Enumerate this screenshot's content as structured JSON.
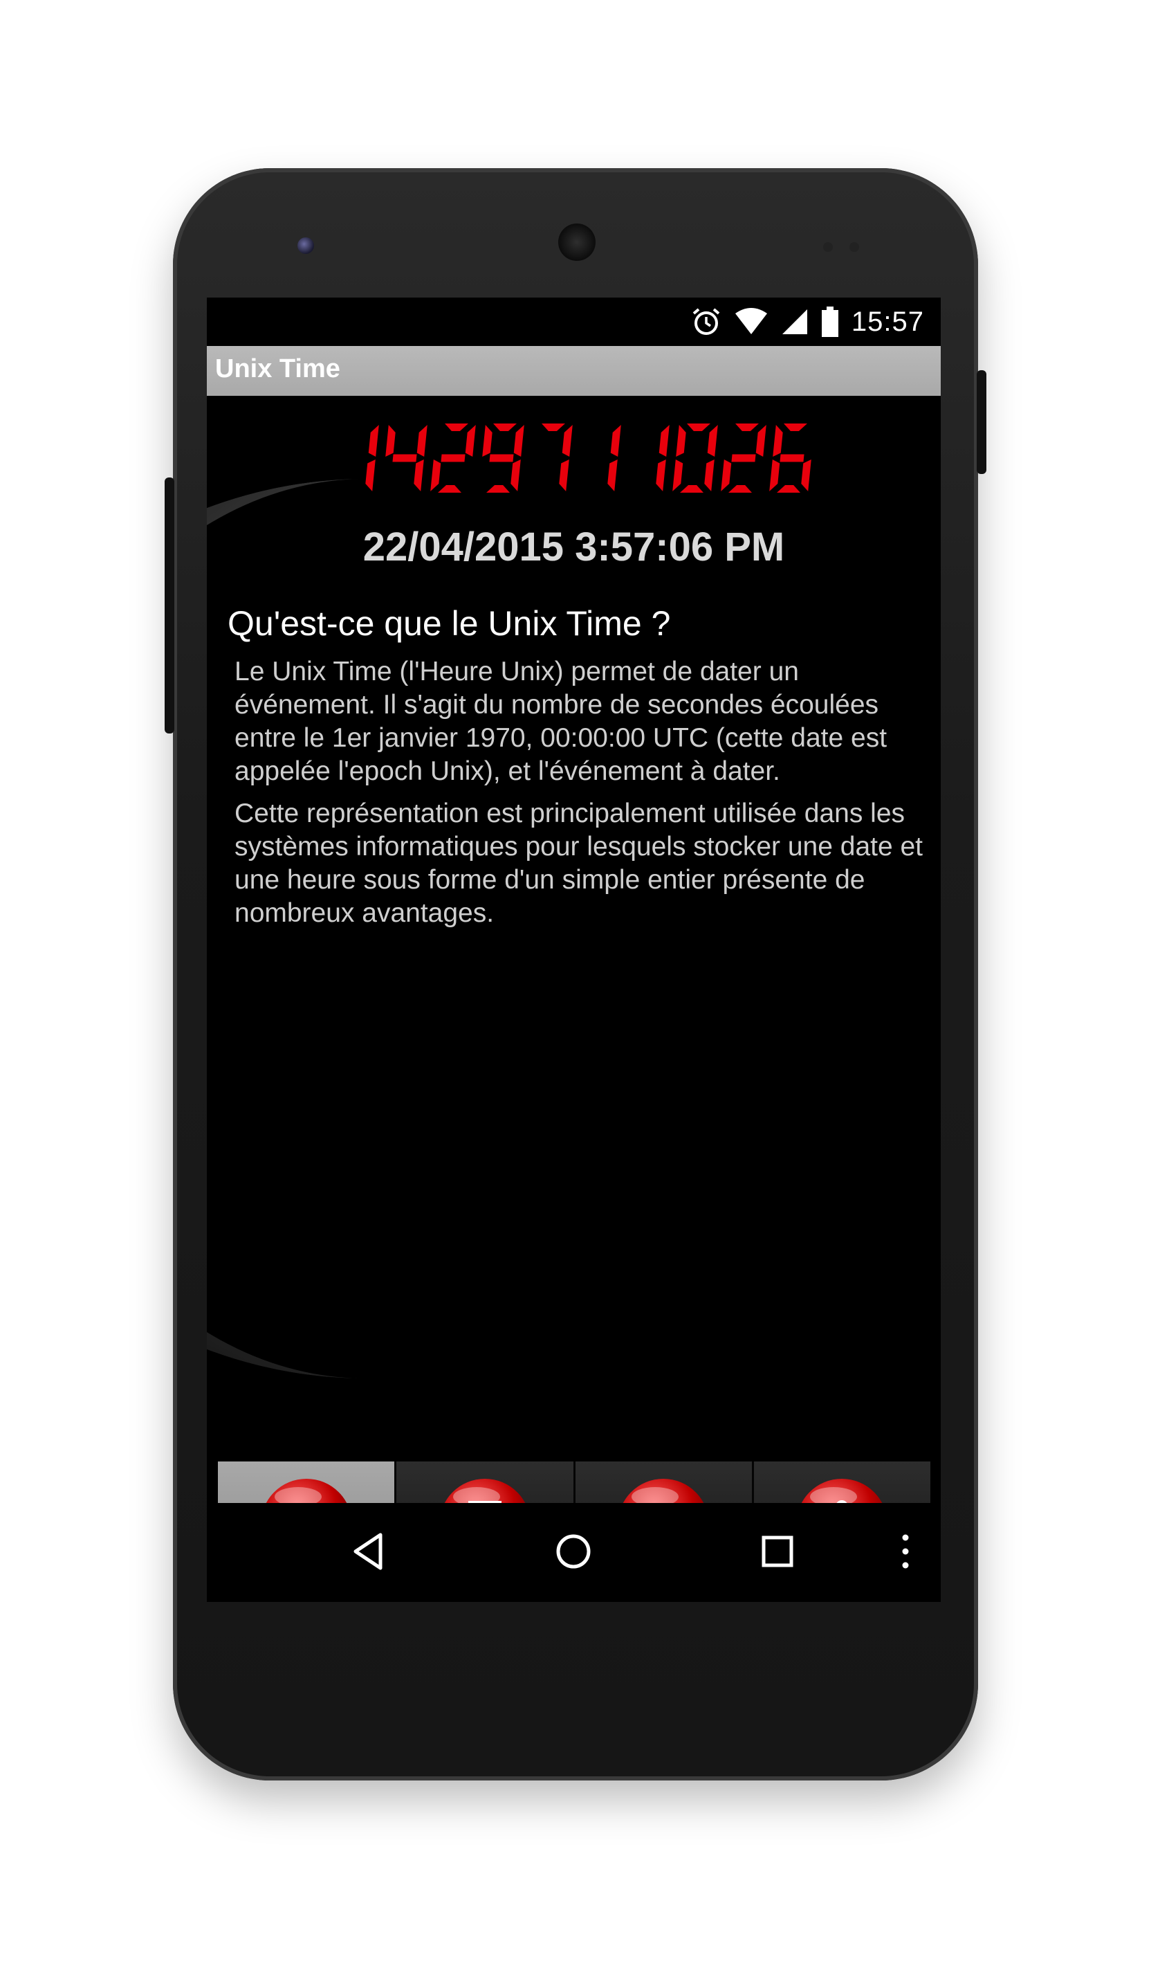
{
  "status_bar": {
    "time": "15:57",
    "icons": [
      "alarm-icon",
      "wifi-icon",
      "signal-icon",
      "battery-icon"
    ]
  },
  "app_bar": {
    "title": "Unix Time"
  },
  "clock": {
    "unix_timestamp": "1429711026",
    "date_time": "22/04/2015 3:57:06 PM",
    "lcd_color": "#e8000c"
  },
  "article": {
    "heading": "Qu'est-ce que le Unix Time ?",
    "paragraphs": [
      "Le Unix Time (l'Heure Unix) permet de dater un événement. Il s'agit du nombre de secondes écoulées entre le 1er janvier 1970, 00:00:00 UTC (cette date est appelée l'epoch Unix), et l'événement à dater.",
      "Cette représentation est principalement utilisée dans les systèmes informatiques pour lesquels stocker une date et une heure sous forme d'un simple entier présente de nombreux avantages."
    ]
  },
  "tabs": [
    {
      "icon": "book-icon",
      "active": true
    },
    {
      "icon": "hourglass-icon",
      "active": false
    },
    {
      "icon": "calendar-icon",
      "active": false
    },
    {
      "icon": "info-icon",
      "active": false
    }
  ],
  "nav_bar": {
    "icons": [
      "back-icon",
      "home-icon",
      "recents-icon",
      "menu-icon"
    ]
  }
}
